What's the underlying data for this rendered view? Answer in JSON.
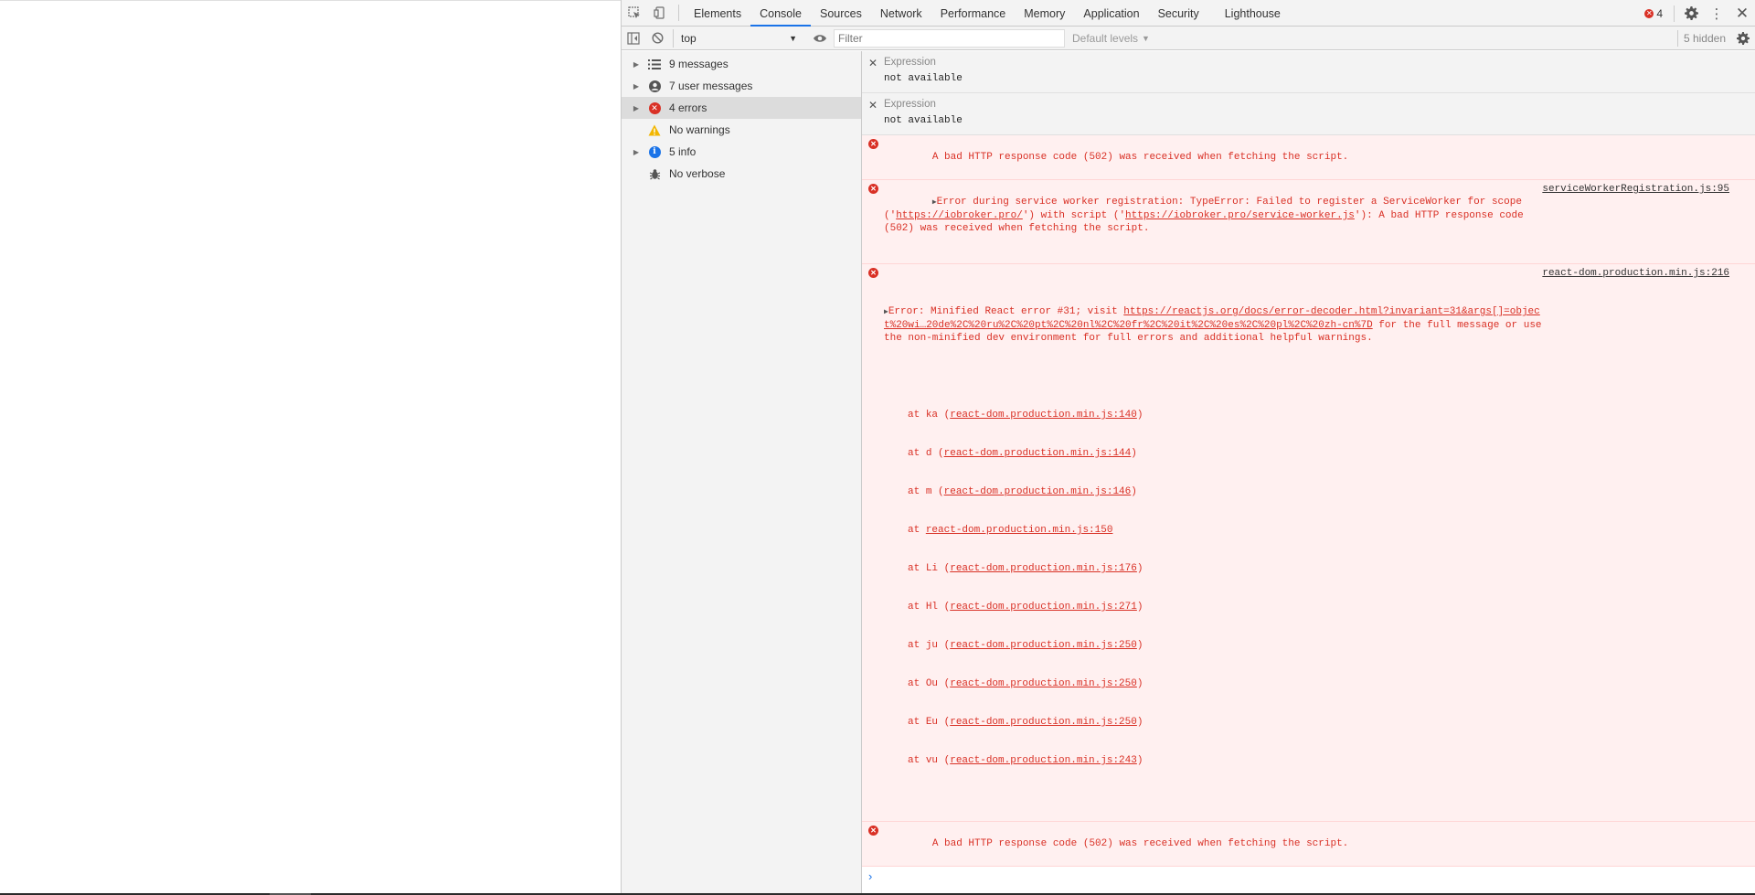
{
  "tabbar": {
    "tabs": [
      {
        "label": "Elements"
      },
      {
        "label": "Console"
      },
      {
        "label": "Sources"
      },
      {
        "label": "Network"
      },
      {
        "label": "Performance"
      },
      {
        "label": "Memory"
      },
      {
        "label": "Application"
      },
      {
        "label": "Security"
      },
      {
        "label": "Lighthouse"
      }
    ],
    "active_tab": "Console",
    "error_count": "4"
  },
  "console_toolbar": {
    "context": "top",
    "filter_placeholder": "Filter",
    "levels_label": "Default levels",
    "hidden_label": "5 hidden"
  },
  "sidebar": {
    "items": [
      {
        "label": "9 messages",
        "icon": "list-icon"
      },
      {
        "label": "7 user messages",
        "icon": "user-icon"
      },
      {
        "label": "4 errors",
        "icon": "error-icon"
      },
      {
        "label": "No warnings",
        "icon": "warning-icon"
      },
      {
        "label": "5 info",
        "icon": "info-icon"
      },
      {
        "label": "No verbose",
        "icon": "bug-icon"
      }
    ]
  },
  "expressions": [
    {
      "label": "Expression",
      "value": "not available"
    },
    {
      "label": "Expression",
      "value": "not available"
    }
  ],
  "messages": {
    "m1": {
      "text": "A bad HTTP response code (502) was received when fetching the script."
    },
    "m2": {
      "pre": "Error during service worker registration: TypeError: Failed to register a ServiceWorker for scope ('",
      "link1": "https://iobroker.pro/",
      "mid": "') with script ('",
      "link2": "https://iobroker.pro/service-worker.js",
      "post": "'): A bad HTTP response code (502) was received when fetching the script.",
      "source": "serviceWorkerRegistration.js:95"
    },
    "m3": {
      "pre": "Error: Minified React error #31; visit ",
      "link": "https://reactjs.org/docs/error-decoder.html?invariant=31&args[]=object%20wi…20de%2C%20ru%2C%20pt%2C%20nl%2C%20fr%2C%20it%2C%20es%2C%20pl%2C%20zh-cn%7D",
      "post": " for the full message or use the non-minified dev environment for full errors and additional helpful warnings.",
      "source": "react-dom.production.min.js:216",
      "stack": [
        {
          "fn": "ka",
          "ref": "react-dom.production.min.js:140"
        },
        {
          "fn": "d",
          "ref": "react-dom.production.min.js:144"
        },
        {
          "fn": "m",
          "ref": "react-dom.production.min.js:146"
        },
        {
          "fn": "",
          "ref": "react-dom.production.min.js:150"
        },
        {
          "fn": "Li",
          "ref": "react-dom.production.min.js:176"
        },
        {
          "fn": "Hl",
          "ref": "react-dom.production.min.js:271"
        },
        {
          "fn": "ju",
          "ref": "react-dom.production.min.js:250"
        },
        {
          "fn": "Ou",
          "ref": "react-dom.production.min.js:250"
        },
        {
          "fn": "Eu",
          "ref": "react-dom.production.min.js:250"
        },
        {
          "fn": "vu",
          "ref": "react-dom.production.min.js:243"
        }
      ]
    },
    "m4": {
      "text": "A bad HTTP response code (502) was received when fetching the script."
    }
  },
  "colors": {
    "error": "#d93025",
    "error_bg": "#fff0f0",
    "accent": "#1a73e8",
    "toolbar_bg": "#f3f3f3"
  }
}
